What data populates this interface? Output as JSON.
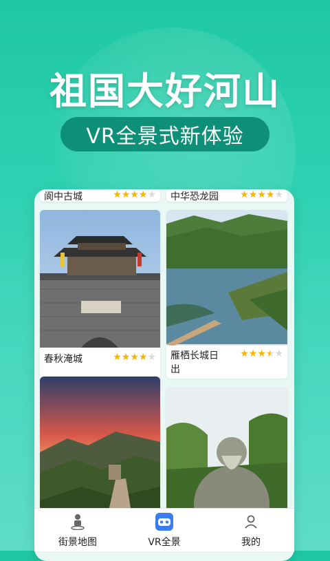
{
  "hero": {
    "title": "祖国大好河山",
    "subtitle": "VR全景式新体验"
  },
  "cards": [
    {
      "title": "阆中古城",
      "rating": 4
    },
    {
      "title": "中华恐龙园",
      "rating": 4
    },
    {
      "title": "春秋淹城",
      "rating": 4
    },
    {
      "title": "雁栖长城日出",
      "rating": 3.5
    }
  ],
  "tabs": [
    {
      "label": "街景地图",
      "icon": "street-view-icon"
    },
    {
      "label": "VR全景",
      "icon": "vr-headset-icon"
    },
    {
      "label": "我的",
      "icon": "profile-icon"
    }
  ],
  "colors": {
    "background_top": "#1fc8a2",
    "background_bottom": "#5fdcc8",
    "pill": "#0e8f78",
    "star": "#f5b400",
    "star_off": "#d9d9d9",
    "vr_icon": "#3b7cf0"
  }
}
